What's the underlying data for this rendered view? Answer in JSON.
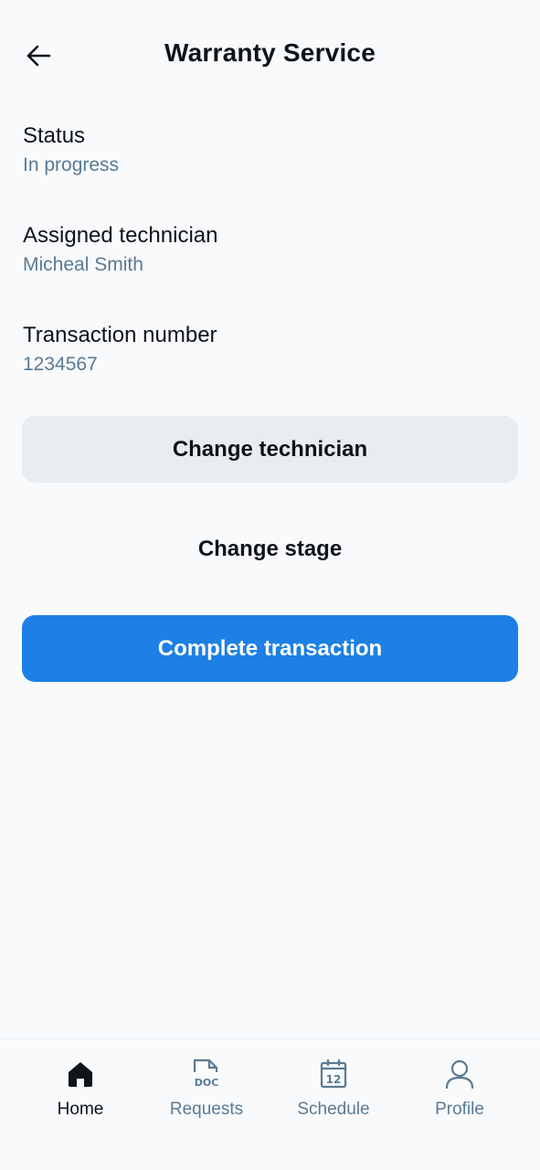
{
  "header": {
    "title": "Warranty Service",
    "back_icon": "arrow-left-icon"
  },
  "details": {
    "status": {
      "label": "Status",
      "value": "In progress"
    },
    "technician": {
      "label": "Assigned technician",
      "value": "Micheal Smith"
    },
    "transaction": {
      "label": "Transaction number",
      "value": "1234567"
    }
  },
  "actions": {
    "change_technician": "Change technician",
    "change_stage": "Change stage",
    "complete_transaction": "Complete transaction"
  },
  "nav": {
    "items": [
      {
        "label": "Home",
        "icon": "home-icon",
        "active": true
      },
      {
        "label": "Requests",
        "icon": "document-icon",
        "icon_text": "DOC",
        "active": false
      },
      {
        "label": "Schedule",
        "icon": "calendar-icon",
        "icon_text": "12",
        "active": false
      },
      {
        "label": "Profile",
        "icon": "user-icon",
        "active": false
      }
    ]
  },
  "colors": {
    "background": "#f8fafc",
    "text_primary": "#0f141a",
    "text_secondary": "#5a7a93",
    "accent": "#1c80e4",
    "secondary_button": "#e8edf2"
  }
}
